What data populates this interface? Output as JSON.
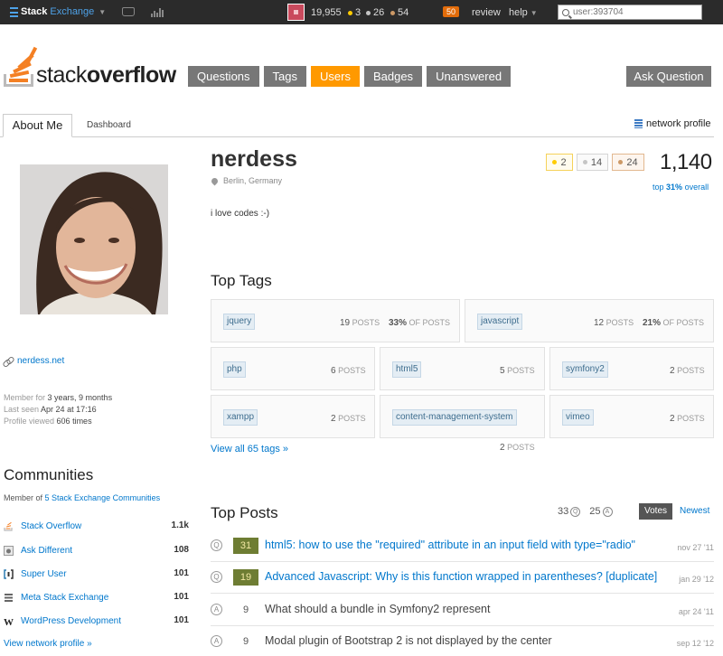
{
  "topbar": {
    "brand_stack": "Stack",
    "brand_exchange": "Exchange",
    "reputation": "19,955",
    "gold_badges": "3",
    "silver_badges": "26",
    "bronze_badges": "54",
    "review_count": "50",
    "review_label": "review",
    "help_label": "help",
    "search_placeholder": "user:393704"
  },
  "header": {
    "logo_light": "stack",
    "logo_bold": "overflow",
    "nav": [
      {
        "label": "Questions"
      },
      {
        "label": "Tags"
      },
      {
        "label": "Users",
        "active": true
      },
      {
        "label": "Badges"
      },
      {
        "label": "Unanswered"
      }
    ],
    "ask_label": "Ask Question"
  },
  "tabs": {
    "about": "About Me",
    "dashboard": "Dashboard",
    "network_profile": "network profile"
  },
  "profile": {
    "name": "nerdess",
    "location": "Berlin, Germany",
    "about": "i love codes :-)",
    "website": "nerdess.net",
    "member_for_label": "Member for",
    "member_for": "3 years, 9 months",
    "last_seen_label": "Last seen",
    "last_seen": "Apr 24 at 17:16",
    "views_label": "Profile viewed",
    "views": "606 times",
    "badges": {
      "gold": "2",
      "silver": "14",
      "bronze": "24"
    },
    "reputation": "1,140",
    "rank_prefix": "top",
    "rank_pct": "31%",
    "rank_suffix": "overall"
  },
  "communities": {
    "title": "Communities",
    "member_prefix": "Member of",
    "member_link": "5 Stack Exchange Communities",
    "items": [
      {
        "name": "Stack Overflow",
        "rep": "1.1k",
        "icon": "stack-overflow-icon"
      },
      {
        "name": "Ask Different",
        "rep": "108",
        "icon": "ask-different-icon"
      },
      {
        "name": "Super User",
        "rep": "101",
        "icon": "super-user-icon"
      },
      {
        "name": "Meta Stack Exchange",
        "rep": "101",
        "icon": "meta-stack-exchange-icon"
      },
      {
        "name": "WordPress Development",
        "rep": "101",
        "icon": "wordpress-icon"
      }
    ],
    "view_network": "View network profile »"
  },
  "top_tags": {
    "title": "Top Tags",
    "posts_word": "POSTS",
    "of_posts_word": "OF POSTS",
    "items": [
      {
        "tag": "jquery",
        "posts": "19",
        "pct": "33%"
      },
      {
        "tag": "javascript",
        "posts": "12",
        "pct": "21%"
      },
      {
        "tag": "php",
        "posts": "6"
      },
      {
        "tag": "html5",
        "posts": "5"
      },
      {
        "tag": "symfony2",
        "posts": "2"
      },
      {
        "tag": "xampp",
        "posts": "2"
      },
      {
        "tag": "content-management-system",
        "posts": "2"
      },
      {
        "tag": "vimeo",
        "posts": "2"
      }
    ],
    "view_all": "View all 65 tags »"
  },
  "top_posts": {
    "title": "Top Posts",
    "question_count": "33",
    "answer_count": "25",
    "sort_votes": "Votes",
    "sort_newest": "Newest",
    "q_marker": "Q",
    "a_marker": "A",
    "items": [
      {
        "type": "question",
        "score": "31",
        "accepted": true,
        "title": "html5: how to use the \"required\" attribute in an input field with type=\"radio\"",
        "date": "nov 27 '11"
      },
      {
        "type": "question",
        "score": "19",
        "accepted": true,
        "title": "Advanced Javascript: Why is this function wrapped in parentheses? [duplicate]",
        "date": "jan 29 '12"
      },
      {
        "type": "answer",
        "score": "9",
        "accepted": false,
        "title": "What should a bundle in Symfony2 represent",
        "date": "apr 24 '11"
      },
      {
        "type": "answer",
        "score": "9",
        "accepted": false,
        "title": "Modal plugin of Bootstrap 2 is not displayed by the center",
        "date": "sep 12 '12"
      }
    ]
  },
  "colors": {
    "accent": "#ff9900",
    "link": "#0077cc",
    "nav_gray": "#777777",
    "topbar": "#2b2b2b",
    "accepted_score": "#6e7d33"
  }
}
